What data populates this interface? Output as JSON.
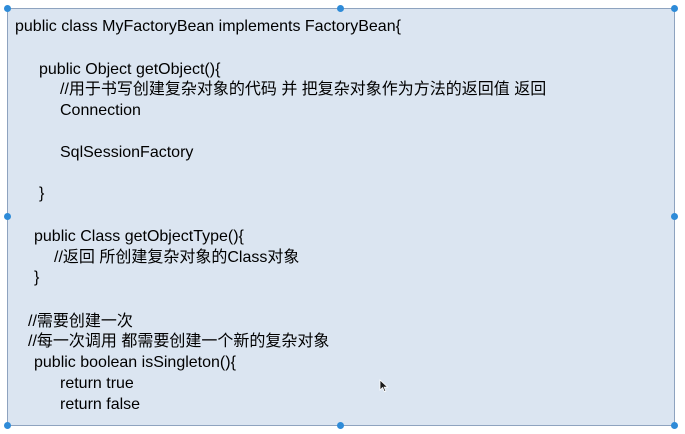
{
  "code": {
    "class_decl": "public class MyFactoryBean implements FactoryBean{",
    "get_object_decl": "public Object getObject(){",
    "get_object_comment": "//用于书写创建复杂对象的代码 并 把复杂对象作为方法的返回值 返回",
    "get_object_example_1": "Connection",
    "get_object_example_2": "SqlSessionFactory",
    "get_object_close": "}",
    "get_object_type_decl": "public Class getObjectType(){",
    "get_object_type_comment": "//返回 所创建复杂对象的Class对象",
    "get_object_type_close": "}",
    "singleton_comment_1": "//需要创建一次",
    "singleton_comment_2": "//每一次调用 都需要创建一个新的复杂对象",
    "is_singleton_decl": "public boolean isSingleton(){",
    "return_true": "return true",
    "return_false": "return false"
  },
  "colors": {
    "box_fill": "#dbe5f1",
    "box_border": "#8ea3bf",
    "handle": "#2e8bd8"
  },
  "icons": {
    "cursor": "mouse-pointer-icon",
    "handle": "selection-handle-icon"
  }
}
